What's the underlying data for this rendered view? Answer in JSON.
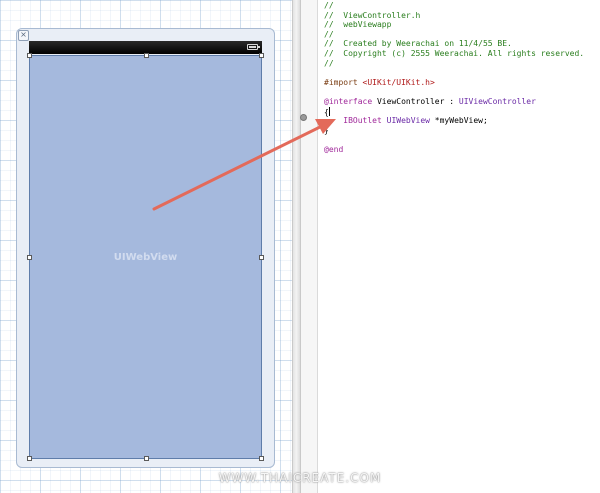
{
  "canvas": {
    "web_view_label": "UIWebView",
    "frame_close_glyph": "×",
    "status_icon": "battery-icon"
  },
  "code": {
    "lines": [
      [
        {
          "t": "//",
          "c": "comment"
        }
      ],
      [
        {
          "t": "//  ViewController.h",
          "c": "comment"
        }
      ],
      [
        {
          "t": "//  webViewapp",
          "c": "comment"
        }
      ],
      [
        {
          "t": "//",
          "c": "comment"
        }
      ],
      [
        {
          "t": "//  Created by Weerachai on 11/4/55 BE.",
          "c": "comment"
        }
      ],
      [
        {
          "t": "//  Copyright (c) 2555 Weerachai. All rights reserved.",
          "c": "comment"
        }
      ],
      [
        {
          "t": "//",
          "c": "comment"
        }
      ],
      [
        {
          "t": "",
          "c": "plain"
        }
      ],
      [
        {
          "t": "#import ",
          "c": "preproc"
        },
        {
          "t": "<UIKit/UIKit.h>",
          "c": "string"
        }
      ],
      [
        {
          "t": "",
          "c": "plain"
        }
      ],
      [
        {
          "t": "@interface",
          "c": "keyword"
        },
        {
          "t": " ViewController : ",
          "c": "plain"
        },
        {
          "t": "UIViewController",
          "c": "type"
        }
      ],
      [
        {
          "t": "{",
          "c": "plain"
        },
        {
          "cursor": true
        }
      ],
      [
        {
          "t": "    ",
          "c": "plain"
        },
        {
          "t": "IBOutlet",
          "c": "keyword"
        },
        {
          "t": " ",
          "c": "plain"
        },
        {
          "t": "UIWebView",
          "c": "type"
        },
        {
          "t": " *myWebView;",
          "c": "plain"
        }
      ],
      [
        {
          "t": "}",
          "c": "plain"
        }
      ],
      [
        {
          "t": "",
          "c": "plain"
        }
      ],
      [
        {
          "t": "@end",
          "c": "keyword"
        }
      ]
    ]
  },
  "colors": {
    "web_view_fill": "#a5b9dd",
    "connection_arrow": "#e36a5a",
    "comment": "#2a7e1e",
    "keyword": "#a0289a"
  },
  "watermark": "WWW.THAICREATE.COM"
}
